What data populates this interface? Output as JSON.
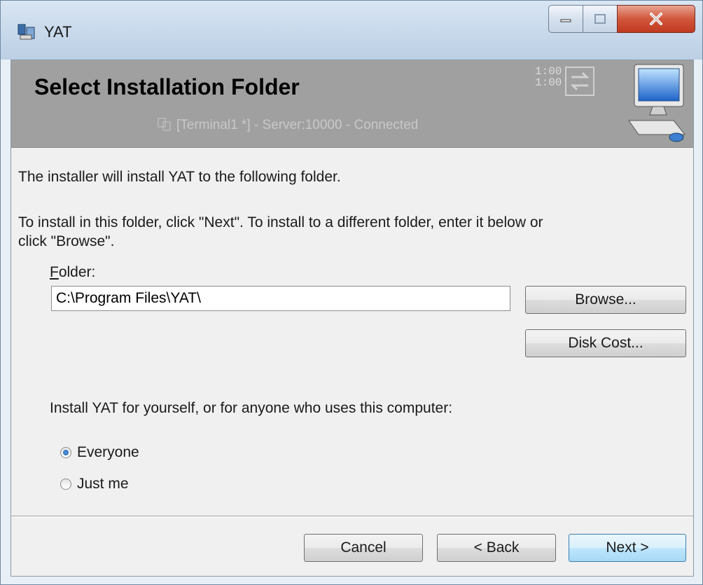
{
  "window": {
    "title": "YAT"
  },
  "banner": {
    "title": "Select Installation Folder",
    "status": "[Terminal1 *] - Server:10000 - Connected",
    "clock_top": "1:00",
    "clock_bottom": "1:00"
  },
  "body": {
    "intro": "The installer will install YAT to the following folder.",
    "instructions_line1": "To install in this folder, click \"Next\". To install to a different folder, enter it below or",
    "instructions_line2": "click \"Browse\".",
    "folder_label_accel": "F",
    "folder_label_rest": "older:",
    "folder_value": "C:\\Program Files\\YAT\\",
    "browse_label": "Browse...",
    "disk_cost_label": "Disk Cost...",
    "install_for_label": "Install YAT for yourself, or for anyone who uses this computer:",
    "options": [
      {
        "label": "Everyone",
        "checked": true
      },
      {
        "label": "Just me",
        "checked": false
      }
    ]
  },
  "footer": {
    "cancel_label": "Cancel",
    "back_label": "< Back",
    "next_label": "Next >"
  }
}
